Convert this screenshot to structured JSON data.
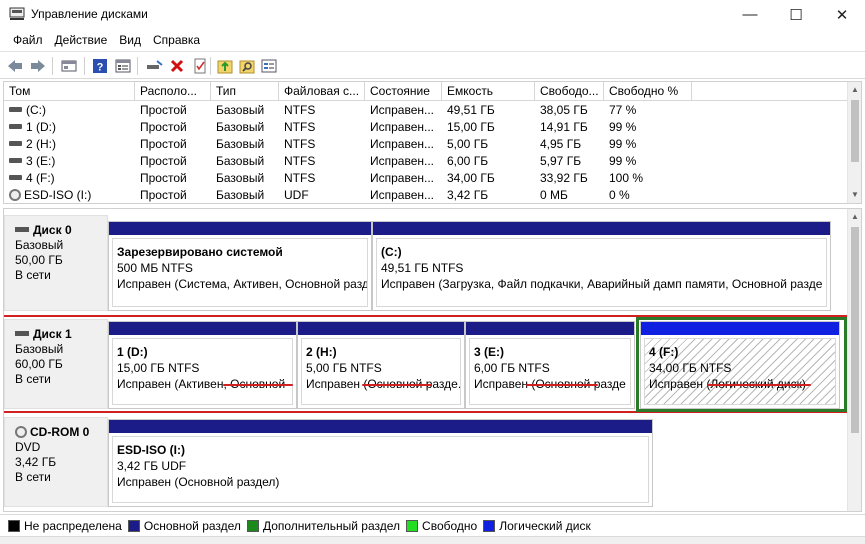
{
  "window": {
    "title": "Управление дисками",
    "min_glyph": "—",
    "max_glyph": "☐",
    "close_glyph": "✕"
  },
  "menu": [
    "Файл",
    "Действие",
    "Вид",
    "Справка"
  ],
  "toolbar_icons": [
    "back-icon",
    "forward-icon",
    "console-icon",
    "help-icon",
    "properties-icon",
    "connect-drive-icon",
    "delete-icon",
    "check-icon",
    "import-icon",
    "search-icon",
    "settings-icon"
  ],
  "volume_table": {
    "columns": [
      "Том",
      "Располо...",
      "Тип",
      "Файловая с...",
      "Состояние",
      "Емкость",
      "Свободо...",
      "Свободно %"
    ],
    "rows": [
      {
        "tom": "(C:)",
        "loc": "Простой",
        "type": "Базовый",
        "fs": "NTFS",
        "state": "Исправен...",
        "cap": "49,51 ГБ",
        "free": "38,05 ГБ",
        "pct": "77 %",
        "icon": "drive-icon"
      },
      {
        "tom": "1 (D:)",
        "loc": "Простой",
        "type": "Базовый",
        "fs": "NTFS",
        "state": "Исправен...",
        "cap": "15,00 ГБ",
        "free": "14,91 ГБ",
        "pct": "99 %",
        "icon": "drive-icon"
      },
      {
        "tom": "2 (H:)",
        "loc": "Простой",
        "type": "Базовый",
        "fs": "NTFS",
        "state": "Исправен...",
        "cap": "5,00 ГБ",
        "free": "4,95 ГБ",
        "pct": "99 %",
        "icon": "drive-icon"
      },
      {
        "tom": "3 (E:)",
        "loc": "Простой",
        "type": "Базовый",
        "fs": "NTFS",
        "state": "Исправен...",
        "cap": "6,00 ГБ",
        "free": "5,97 ГБ",
        "pct": "99 %",
        "icon": "drive-icon"
      },
      {
        "tom": "4 (F:)",
        "loc": "Простой",
        "type": "Базовый",
        "fs": "NTFS",
        "state": "Исправен...",
        "cap": "34,00 ГБ",
        "free": "33,92 ГБ",
        "pct": "100 %",
        "icon": "drive-icon"
      },
      {
        "tom": "ESD-ISO (I:)",
        "loc": "Простой",
        "type": "Базовый",
        "fs": "UDF",
        "state": "Исправен...",
        "cap": "3,42 ГБ",
        "free": "0 МБ",
        "pct": "0 %",
        "icon": "cd-icon"
      }
    ]
  },
  "disks": [
    {
      "name": "Диск 0",
      "type": "Базовый",
      "size": "50,00 ГБ",
      "status": "В сети",
      "partitions": [
        {
          "name": "Зарезервировано системой",
          "size": "500 МБ NTFS",
          "status": "Исправен (Система, Активен, Основной разд"
        },
        {
          "name": "(C:)",
          "size": "49,51 ГБ NTFS",
          "status": "Исправен (Загрузка, Файл подкачки, Аварийный дамп памяти, Основной разде"
        }
      ]
    },
    {
      "name": "Диск 1",
      "type": "Базовый",
      "size": "60,00 ГБ",
      "status": "В сети",
      "partitions": [
        {
          "name": "1  (D:)",
          "size": "15,00 ГБ NTFS",
          "status": "Исправен (Активен, Основной"
        },
        {
          "name": "2  (H:)",
          "size": "5,00 ГБ NTFS",
          "status": "Исправен (Основной разде."
        },
        {
          "name": "3  (E:)",
          "size": "6,00 ГБ NTFS",
          "status": "Исправен (Основной разде"
        },
        {
          "name": "4  (F:)",
          "size": "34,00 ГБ NTFS",
          "status": "Исправен (Логический диск)"
        }
      ]
    },
    {
      "name": "CD-ROM 0",
      "type": "DVD",
      "size": "3,42 ГБ",
      "status": "В сети",
      "partitions": [
        {
          "name": "ESD-ISO  (I:)",
          "size": "3,42 ГБ UDF",
          "status": "Исправен (Основной раздел)"
        }
      ]
    }
  ],
  "legend": [
    {
      "label": "Не распределена",
      "color": "#000000"
    },
    {
      "label": "Основной раздел",
      "color": "#1c1c88"
    },
    {
      "label": "Дополнительный раздел",
      "color": "#1a8a1a"
    },
    {
      "label": "Свободно",
      "color": "#22dd22"
    },
    {
      "label": "Логический диск",
      "color": "#1020e0"
    }
  ],
  "colors": {
    "primary_partition": "#1c1c88",
    "logical_partition": "#1020e0",
    "annotation_red": "#d02020",
    "annotation_green": "#2a7a2a"
  }
}
